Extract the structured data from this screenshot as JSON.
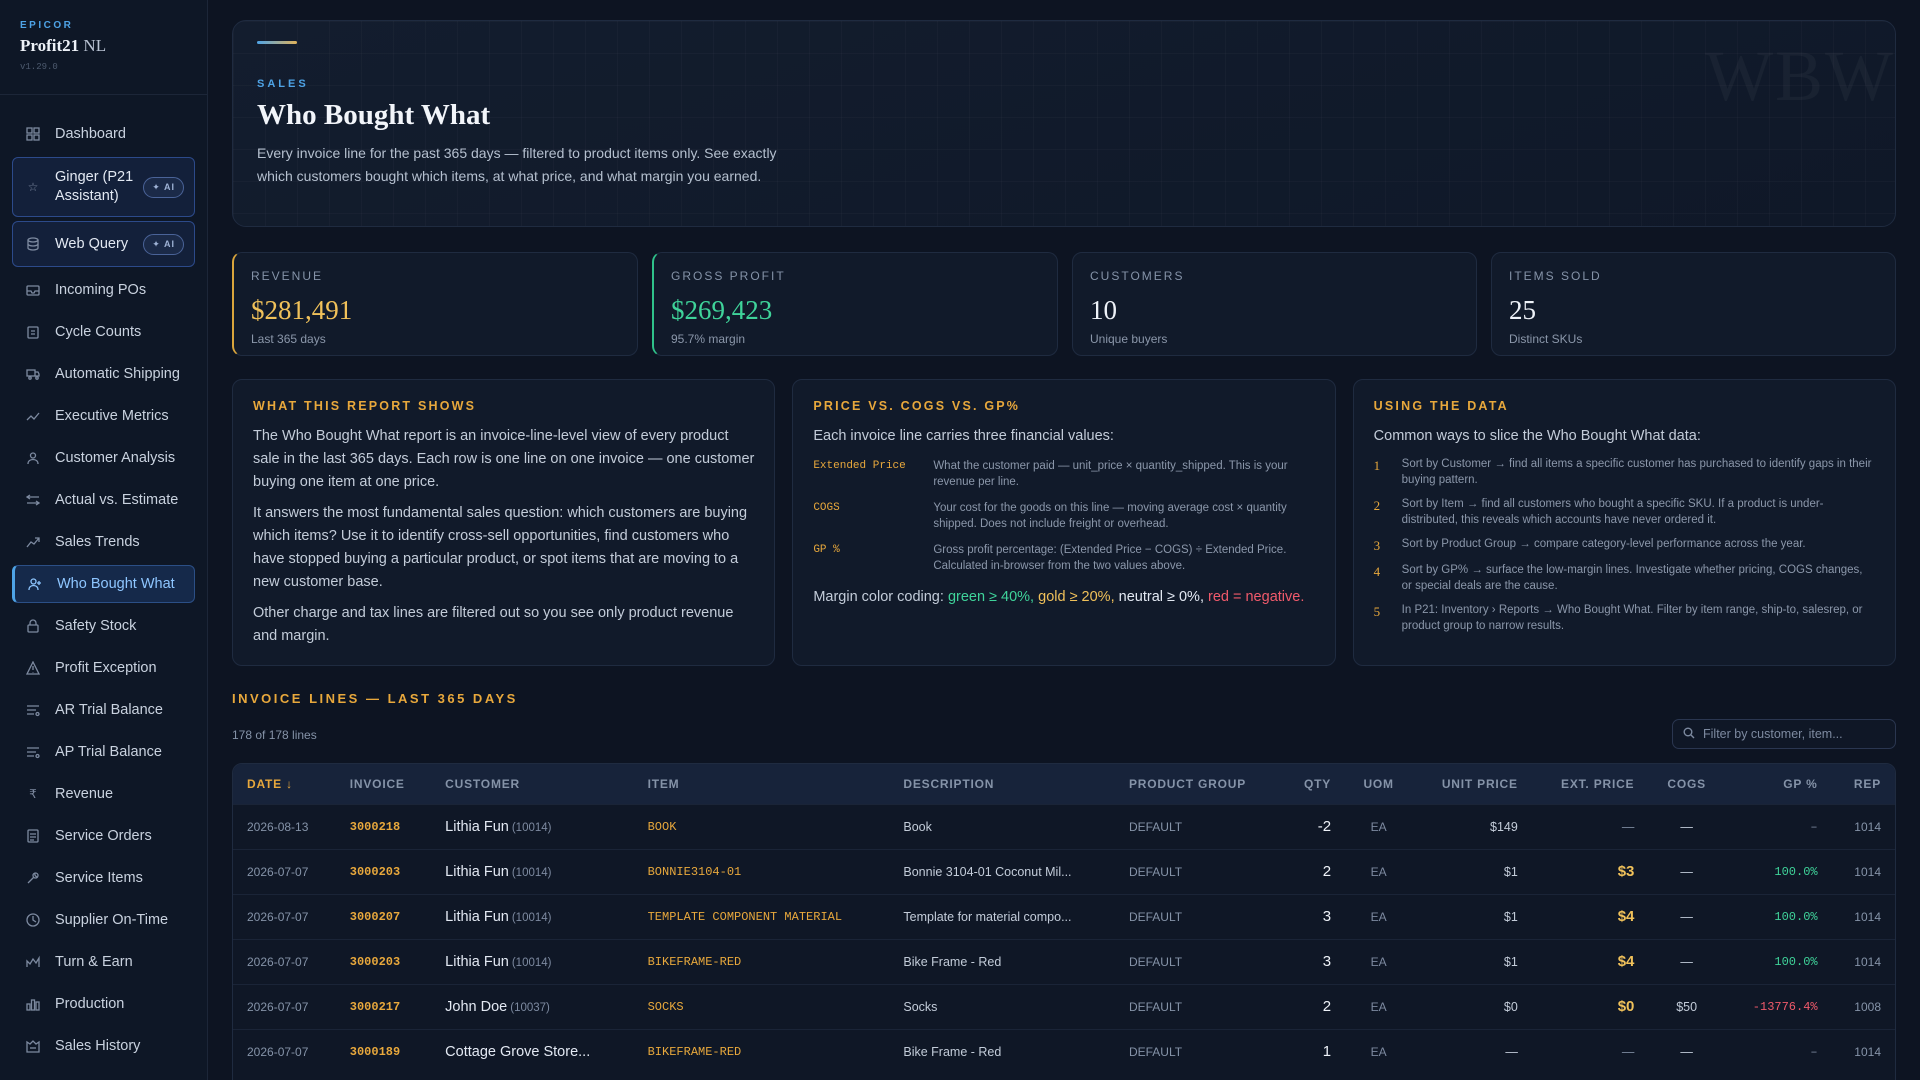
{
  "brand": {
    "kicker": "EPICOR",
    "name": "Profit21",
    "name_suffix": "NL",
    "version": "v1.29.0"
  },
  "sidebar": {
    "items": [
      {
        "label": "Dashboard",
        "icon": "grid-icon"
      },
      {
        "label": "Ginger (P21 Assistant)",
        "icon": "star-icon",
        "badge": "✦ AI"
      },
      {
        "label": "Web Query",
        "icon": "database-icon",
        "badge": "✦ AI"
      },
      {
        "label": "Incoming POs",
        "icon": "inbox-icon"
      },
      {
        "label": "Cycle Counts",
        "icon": "clipboard-icon"
      },
      {
        "label": "Automatic Shipping",
        "icon": "truck-icon"
      },
      {
        "label": "Executive Metrics",
        "icon": "trend-icon"
      },
      {
        "label": "Customer Analysis",
        "icon": "user-icon"
      },
      {
        "label": "Actual vs. Estimate",
        "icon": "compare-icon"
      },
      {
        "label": "Sales Trends",
        "icon": "trend-up-icon"
      },
      {
        "label": "Who Bought What",
        "icon": "user-plus-icon"
      },
      {
        "label": "Safety Stock",
        "icon": "lock-icon"
      },
      {
        "label": "Profit Exception",
        "icon": "warning-icon"
      },
      {
        "label": "AR Trial Balance",
        "icon": "ledger-icon"
      },
      {
        "label": "AP Trial Balance",
        "icon": "ledger-icon"
      },
      {
        "label": "Revenue",
        "icon": "currency-icon"
      },
      {
        "label": "Service Orders",
        "icon": "document-icon"
      },
      {
        "label": "Service Items",
        "icon": "wrench-icon"
      },
      {
        "label": "Supplier On-Time",
        "icon": "clock-icon"
      },
      {
        "label": "Turn & Earn",
        "icon": "cycle-icon"
      },
      {
        "label": "Production",
        "icon": "bar-chart-icon"
      },
      {
        "label": "Sales History",
        "icon": "history-icon"
      }
    ]
  },
  "hero": {
    "kicker": "SALES",
    "title": "Who Bought What",
    "description": "Every invoice line for the past 365 days — filtered to product items only. See exactly which customers bought which items, at what price, and what margin you earned.",
    "watermark": "WBW"
  },
  "stats": [
    {
      "label": "REVENUE",
      "value": "$281,491",
      "sub": "Last 365 days"
    },
    {
      "label": "GROSS PROFIT",
      "value": "$269,423",
      "sub": "95.7% margin"
    },
    {
      "label": "CUSTOMERS",
      "value": "10",
      "sub": "Unique buyers"
    },
    {
      "label": "ITEMS SOLD",
      "value": "25",
      "sub": "Distinct SKUs"
    }
  ],
  "cards": {
    "shows": {
      "title": "WHAT THIS REPORT SHOWS",
      "p1": "The Who Bought What report is an invoice-line-level view of every product sale in the last 365 days. Each row is one line on one invoice — one customer buying one item at one price.",
      "p2": "It answers the most fundamental sales question: which customers are buying which items? Use it to identify cross-sell opportunities, find customers who have stopped buying a particular product, or spot items that are moving to a new customer base.",
      "p3": "Other charge and tax lines are filtered out so you see only product revenue and margin."
    },
    "price": {
      "title": "PRICE VS. COGS VS. GP%",
      "intro": "Each invoice line carries three financial values:",
      "defs": [
        {
          "key": "Extended Price",
          "val": "What the customer paid — unit_price × quantity_shipped. This is your revenue per line."
        },
        {
          "key": "COGS",
          "val": "Your cost for the goods on this line — moving average cost × quantity shipped. Does not include freight or overhead."
        },
        {
          "key": "GP %",
          "val": "Gross profit percentage: (Extended Price − COGS) ÷ Extended Price. Calculated in-browser from the two values above."
        }
      ],
      "margin_prefix": "Margin color coding:",
      "margin_green": "green ≥ 40%,",
      "margin_gold": "gold ≥ 20%,",
      "margin_neutral": "neutral ≥ 0%,",
      "margin_red": "red = negative."
    },
    "using": {
      "title": "USING THE DATA",
      "intro": "Common ways to slice the Who Bought What data:",
      "items": [
        {
          "num": "1",
          "text": "Sort by Customer → find all items a specific customer has purchased to identify gaps in their buying pattern."
        },
        {
          "num": "2",
          "text": "Sort by Item → find all customers who bought a specific SKU. If a product is under-distributed, this reveals which accounts have never ordered it."
        },
        {
          "num": "3",
          "text": "Sort by Product Group → compare category-level performance across the year."
        },
        {
          "num": "4",
          "text": "Sort by GP% → surface the low-margin lines. Investigate whether pricing, COGS changes, or special deals are the cause."
        },
        {
          "num": "5",
          "text": "In P21: Inventory › Reports → Who Bought What. Filter by item range, ship-to, salesrep, or product group to narrow results."
        }
      ]
    }
  },
  "table": {
    "section_title": "INVOICE LINES — LAST 365 DAYS",
    "count": "178 of 178 lines",
    "filter_placeholder": "Filter by customer, item...",
    "headers": {
      "date": "DATE ↓",
      "invoice": "INVOICE",
      "customer": "CUSTOMER",
      "item": "ITEM",
      "description": "DESCRIPTION",
      "product_group": "PRODUCT GROUP",
      "qty": "QTY",
      "uom": "UOM",
      "unit_price": "UNIT PRICE",
      "ext_price": "EXT. PRICE",
      "cogs": "COGS",
      "gp": "GP %",
      "rep": "REP"
    },
    "rows": [
      {
        "date": "2026-08-13",
        "invoice": "3000218",
        "customer": "Lithia Fun",
        "cid": "(10014)",
        "item": "BOOK",
        "description": "Book",
        "pg": "DEFAULT",
        "qty": "-2",
        "uom": "EA",
        "unit_price": "$149",
        "ext": "—",
        "cogs": "—",
        "gp": "–",
        "gp_class": "none",
        "rep": "1014"
      },
      {
        "date": "2026-07-07",
        "invoice": "3000203",
        "customer": "Lithia Fun",
        "cid": "(10014)",
        "item": "BONNIE3104-01",
        "description": "Bonnie 3104-01 Coconut Mil...",
        "pg": "DEFAULT",
        "qty": "2",
        "uom": "EA",
        "unit_price": "$1",
        "ext": "$3",
        "cogs": "—",
        "gp": "100.0%",
        "gp_class": "pos",
        "rep": "1014"
      },
      {
        "date": "2026-07-07",
        "invoice": "3000207",
        "customer": "Lithia Fun",
        "cid": "(10014)",
        "item": "TEMPLATE COMPONENT MATERIAL",
        "description": "Template for material compo...",
        "pg": "DEFAULT",
        "qty": "3",
        "uom": "EA",
        "unit_price": "$1",
        "ext": "$4",
        "cogs": "—",
        "gp": "100.0%",
        "gp_class": "pos",
        "rep": "1014"
      },
      {
        "date": "2026-07-07",
        "invoice": "3000203",
        "customer": "Lithia Fun",
        "cid": "(10014)",
        "item": "BIKEFRAME-RED",
        "description": "Bike Frame - Red",
        "pg": "DEFAULT",
        "qty": "3",
        "uom": "EA",
        "unit_price": "$1",
        "ext": "$4",
        "cogs": "—",
        "gp": "100.0%",
        "gp_class": "pos",
        "rep": "1014"
      },
      {
        "date": "2026-07-07",
        "invoice": "3000217",
        "customer": "John Doe",
        "cid": "(10037)",
        "item": "SOCKS",
        "description": "Socks",
        "pg": "DEFAULT",
        "qty": "2",
        "uom": "EA",
        "unit_price": "$0",
        "ext": "$0",
        "cogs": "$50",
        "gp": "-13776.4%",
        "gp_class": "neg",
        "rep": "1008"
      },
      {
        "date": "2026-07-07",
        "invoice": "3000189",
        "customer": "Cottage Grove Store...",
        "cid": "",
        "item": "BIKEFRAME-RED",
        "description": "Bike Frame - Red",
        "pg": "DEFAULT",
        "qty": "1",
        "uom": "EA",
        "unit_price": "—",
        "ext": "—",
        "cogs": "—",
        "gp": "–",
        "gp_class": "none",
        "rep": "1014"
      }
    ]
  }
}
